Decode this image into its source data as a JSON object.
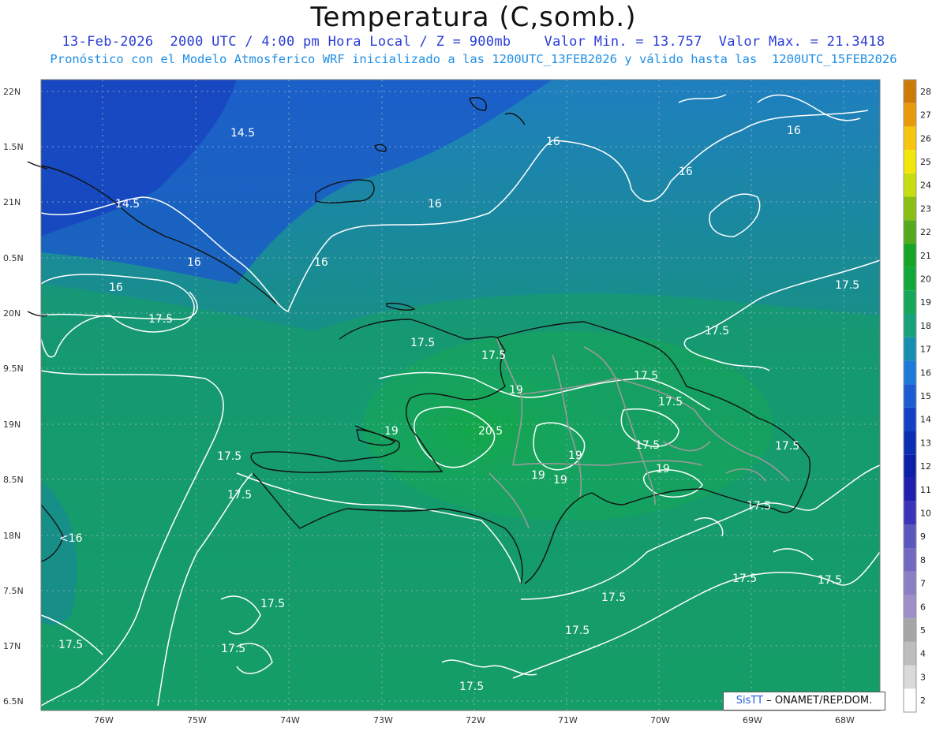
{
  "header": {
    "title": "Temperatura (C,somb.)",
    "line1": "13-Feb-2026  2000 UTC / 4:00 pm Hora Local / Z = 900mb    Valor Min. = 13.757  Valor Max. = 21.3418",
    "line2": "Pronóstico con el Modelo Atmosferico WRF inicializado a las 1200UTC_13FEB2026 y válido hasta las  1200UTC_15FEB2026"
  },
  "axes": {
    "x_ticks": [
      "76W",
      "75W",
      "74W",
      "73W",
      "72W",
      "71W",
      "70W",
      "69W",
      "68W"
    ],
    "y_ticks": [
      "22N",
      "21.5N",
      "21N",
      "20.5N",
      "20N",
      "19.5N",
      "19N",
      "18.5N",
      "18N",
      "17.5N",
      "17N",
      "16.5N"
    ],
    "y_ticks_displayed": [
      "22N",
      "1.5N",
      "21N",
      "0.5N",
      "20N",
      "9.5N",
      "19N",
      "8.5N",
      "18N",
      "7.5N",
      "17N",
      "6.5N"
    ]
  },
  "colorbar": {
    "levels": [
      "2",
      "3",
      "4",
      "5",
      "6",
      "7",
      "8",
      "9",
      "10",
      "11",
      "12",
      "13",
      "14",
      "15",
      "16",
      "17",
      "18",
      "19",
      "20",
      "21",
      "22",
      "23",
      "24",
      "25",
      "26",
      "27",
      "28"
    ],
    "colors": [
      "#ffffff",
      "#d9d9d9",
      "#bdbdbd",
      "#a6a6a6",
      "#9f8fc8",
      "#8a7fc4",
      "#7268c0",
      "#5a58bd",
      "#3a34b8",
      "#1f1fae",
      "#0d1fa8",
      "#0b2db3",
      "#1340c4",
      "#1b5bd3",
      "#1c7ad8",
      "#188fb0",
      "#16a37c",
      "#15a85a",
      "#12a83a",
      "#17a527",
      "#54a91c",
      "#88bf12",
      "#c6dd10",
      "#f2e70c",
      "#f7c50e",
      "#e99a0c",
      "#cc7a08"
    ]
  },
  "contour_labels": [
    "14.5",
    "14.5",
    "16",
    "16",
    "16",
    "16",
    "16",
    "16",
    "16",
    "17.5",
    "17.5",
    "17.5",
    "17.5",
    "17.5",
    "17.5",
    "17.5",
    "17.5",
    "17.5",
    "17.5",
    "17.5",
    "17.5",
    "17.5",
    "17.5",
    "17.5",
    "17.5",
    "17.5",
    "17.5",
    "17.5",
    "19",
    "19",
    "19",
    "19",
    "19",
    "19",
    "20.5",
    "<16",
    "17.5"
  ],
  "credit": {
    "brand": "SisTT",
    "text": "ONAMET/REP.DOM."
  },
  "map": {
    "region": "Hispaniola",
    "field": "temperature",
    "min": 13.757,
    "max": 21.3418
  }
}
